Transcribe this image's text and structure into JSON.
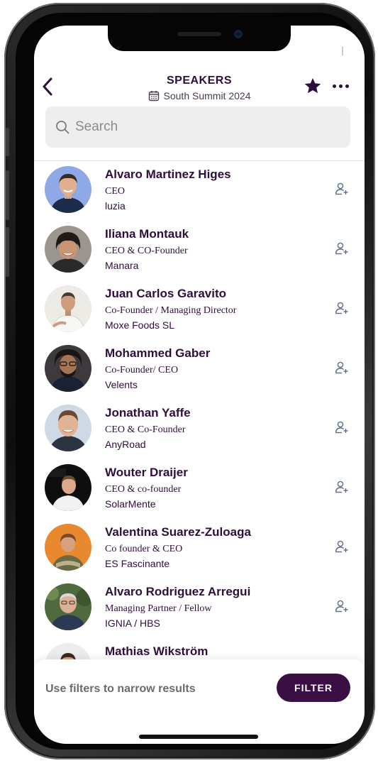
{
  "header": {
    "title": "SPEAKERS",
    "event": "South Summit 2024"
  },
  "search": {
    "placeholder": "Search",
    "value": ""
  },
  "speakers": [
    {
      "name": "Alvaro Martinez Higes",
      "role": "CEO",
      "company": "luzia"
    },
    {
      "name": "Iliana Montauk",
      "role": "CEO & CO-Founder",
      "company": "Manara"
    },
    {
      "name": "Juan Carlos Garavito",
      "role": "Co-Founder / Managing Director",
      "company": "Moxe Foods  SL"
    },
    {
      "name": "Mohammed Gaber",
      "role": "Co-Founder/ CEO",
      "company": "Velents"
    },
    {
      "name": "Jonathan Yaffe",
      "role": "CEO & Co-Founder",
      "company": "AnyRoad"
    },
    {
      "name": "Wouter Draijer",
      "role": "CEO & co-founder",
      "company": "SolarMente"
    },
    {
      "name": "Valentina Suarez-Zuloaga",
      "role": "Co founder & CEO",
      "company": "ES Fascinante"
    },
    {
      "name": "Alvaro Rodriguez Arregui",
      "role": "Managing Partner / Fellow",
      "company": "IGNIA / HBS"
    },
    {
      "name": "Mathias Wikström",
      "role": "",
      "company": ""
    }
  ],
  "bottom": {
    "hint": "Use filters to narrow results",
    "filter_label": "FILTER"
  },
  "colors": {
    "primary": "#2e0e3a",
    "filter_button": "#3a0f43",
    "action_icon": "#5a6b8a"
  }
}
